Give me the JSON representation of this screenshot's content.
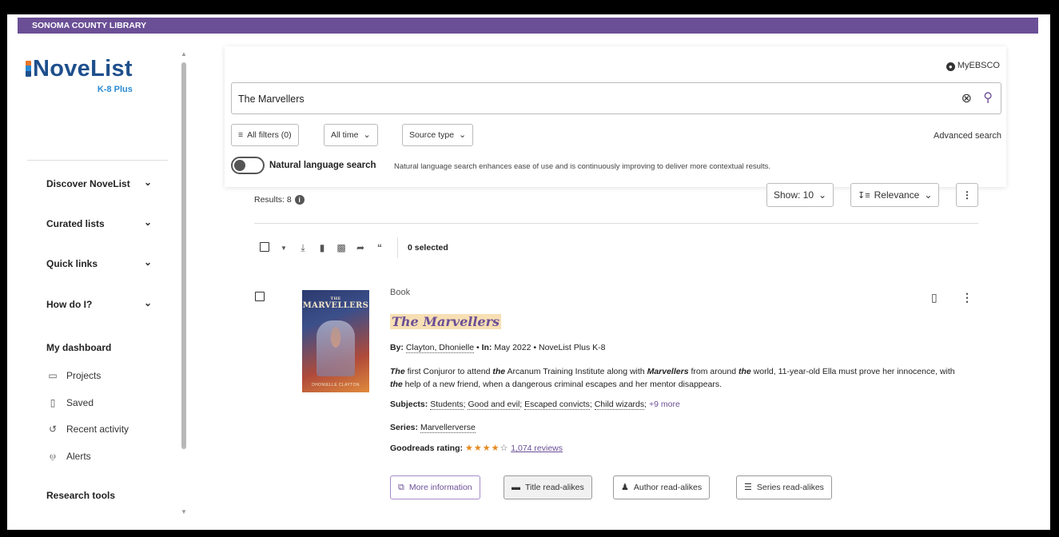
{
  "header": {
    "org_name": "SONOMA COUNTY LIBRARY"
  },
  "logo": {
    "name": "NoveList",
    "subtitle": "K-8 Plus"
  },
  "sidebar": {
    "nav": [
      {
        "label": "Discover NoveList",
        "icon": "chevron-down-icon"
      },
      {
        "label": "Curated lists",
        "icon": "chevron-down-icon"
      },
      {
        "label": "Quick links",
        "icon": "chevron-down-icon"
      },
      {
        "label": "How do I?",
        "icon": "chevron-down-icon"
      }
    ],
    "dashboard_heading": "My dashboard",
    "dashboard_items": [
      {
        "label": "Projects",
        "icon": "folder-icon"
      },
      {
        "label": "Saved",
        "icon": "bookmark-icon"
      },
      {
        "label": "Recent activity",
        "icon": "history-icon"
      },
      {
        "label": "Alerts",
        "icon": "bell-icon"
      }
    ],
    "research_heading": "Research tools"
  },
  "search": {
    "account_label": "MyEBSCO",
    "query": "The Marvellers",
    "filters": [
      {
        "label": "All filters (0)",
        "icon": "filter-icon"
      },
      {
        "label": "All time",
        "icon": "chevron-down-icon"
      },
      {
        "label": "Source type",
        "icon": "chevron-down-icon"
      }
    ],
    "advanced_label": "Advanced search",
    "natural_language": {
      "label": "Natural language search",
      "enabled": false,
      "description": "Natural language search enhances ease of use and is continuously improving to deliver more contextual results."
    }
  },
  "results": {
    "count_label": "Results: 8",
    "show_label": "Show: 10",
    "sort_label": "Relevance",
    "selected_label": "0 selected"
  },
  "record": {
    "type": "Book",
    "title": "The Marvellers",
    "cover": {
      "title": "MARVELLERS",
      "title_small": "THE",
      "author": "DHONIELLE CLAYTON"
    },
    "by_label": "By:",
    "author": "Clayton, Dhonielle",
    "in_label": "In:",
    "date": "May 2022",
    "source": "NoveList Plus K-8",
    "abstract_segments": [
      {
        "t": "The",
        "b": true
      },
      {
        "t": " first Conjuror to attend ",
        "b": false
      },
      {
        "t": "the",
        "b": true
      },
      {
        "t": " Arcanum Training Institute along with ",
        "b": false
      },
      {
        "t": "Marvellers",
        "b": true
      },
      {
        "t": " from around ",
        "b": false
      },
      {
        "t": "the",
        "b": true
      },
      {
        "t": " world, 11-year-old Ella must prove her innocence, with ",
        "b": false
      },
      {
        "t": "the",
        "b": true
      },
      {
        "t": " help of a new friend, when a dangerous criminal escapes and her mentor disappears.",
        "b": false
      }
    ],
    "subjects_label": "Subjects:",
    "subjects": [
      "Students",
      "Good and evil",
      "Escaped convicts",
      "Child wizards"
    ],
    "subjects_more": "+9 more",
    "series_label": "Series:",
    "series": "Marvellerverse",
    "goodreads_label": "Goodreads rating:",
    "rating": 4,
    "rating_max": 5,
    "reviews": "1,074 reviews",
    "actions": [
      {
        "label": "More information",
        "icon": "external-link-icon"
      },
      {
        "label": "Title read-alikes",
        "icon": "book-icon"
      },
      {
        "label": "Author read-alikes",
        "icon": "person-edit-icon"
      },
      {
        "label": "Series read-alikes",
        "icon": "library-icon"
      }
    ]
  },
  "colors": {
    "brand": "#6b4f96",
    "logo_blue": "#1e4f8c",
    "highlight": "#f7dfb4",
    "star": "#e58a1f"
  }
}
